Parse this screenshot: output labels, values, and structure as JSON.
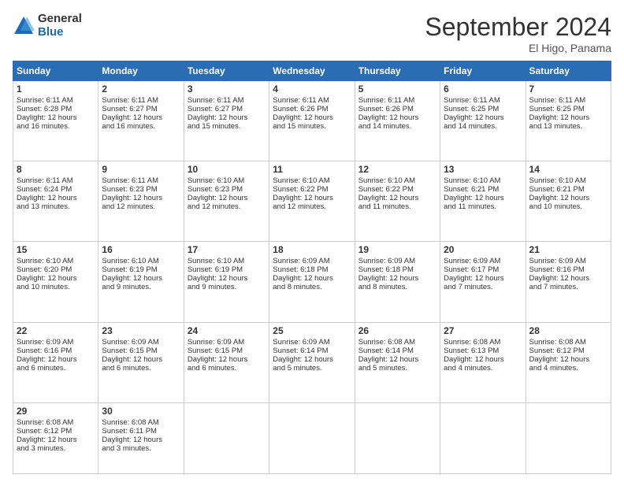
{
  "header": {
    "logo_general": "General",
    "logo_blue": "Blue",
    "month_title": "September 2024",
    "location": "El Higo, Panama"
  },
  "days_of_week": [
    "Sunday",
    "Monday",
    "Tuesday",
    "Wednesday",
    "Thursday",
    "Friday",
    "Saturday"
  ],
  "weeks": [
    [
      {
        "day": 1,
        "sunrise": "6:11 AM",
        "sunset": "6:28 PM",
        "daylight": "12 hours and 16 minutes."
      },
      {
        "day": 2,
        "sunrise": "6:11 AM",
        "sunset": "6:27 PM",
        "daylight": "12 hours and 16 minutes."
      },
      {
        "day": 3,
        "sunrise": "6:11 AM",
        "sunset": "6:27 PM",
        "daylight": "12 hours and 15 minutes."
      },
      {
        "day": 4,
        "sunrise": "6:11 AM",
        "sunset": "6:26 PM",
        "daylight": "12 hours and 15 minutes."
      },
      {
        "day": 5,
        "sunrise": "6:11 AM",
        "sunset": "6:26 PM",
        "daylight": "12 hours and 14 minutes."
      },
      {
        "day": 6,
        "sunrise": "6:11 AM",
        "sunset": "6:25 PM",
        "daylight": "12 hours and 14 minutes."
      },
      {
        "day": 7,
        "sunrise": "6:11 AM",
        "sunset": "6:25 PM",
        "daylight": "12 hours and 13 minutes."
      }
    ],
    [
      {
        "day": 8,
        "sunrise": "6:11 AM",
        "sunset": "6:24 PM",
        "daylight": "12 hours and 13 minutes."
      },
      {
        "day": 9,
        "sunrise": "6:11 AM",
        "sunset": "6:23 PM",
        "daylight": "12 hours and 12 minutes."
      },
      {
        "day": 10,
        "sunrise": "6:10 AM",
        "sunset": "6:23 PM",
        "daylight": "12 hours and 12 minutes."
      },
      {
        "day": 11,
        "sunrise": "6:10 AM",
        "sunset": "6:22 PM",
        "daylight": "12 hours and 12 minutes."
      },
      {
        "day": 12,
        "sunrise": "6:10 AM",
        "sunset": "6:22 PM",
        "daylight": "12 hours and 11 minutes."
      },
      {
        "day": 13,
        "sunrise": "6:10 AM",
        "sunset": "6:21 PM",
        "daylight": "12 hours and 11 minutes."
      },
      {
        "day": 14,
        "sunrise": "6:10 AM",
        "sunset": "6:21 PM",
        "daylight": "12 hours and 10 minutes."
      }
    ],
    [
      {
        "day": 15,
        "sunrise": "6:10 AM",
        "sunset": "6:20 PM",
        "daylight": "12 hours and 10 minutes."
      },
      {
        "day": 16,
        "sunrise": "6:10 AM",
        "sunset": "6:19 PM",
        "daylight": "12 hours and 9 minutes."
      },
      {
        "day": 17,
        "sunrise": "6:10 AM",
        "sunset": "6:19 PM",
        "daylight": "12 hours and 9 minutes."
      },
      {
        "day": 18,
        "sunrise": "6:09 AM",
        "sunset": "6:18 PM",
        "daylight": "12 hours and 8 minutes."
      },
      {
        "day": 19,
        "sunrise": "6:09 AM",
        "sunset": "6:18 PM",
        "daylight": "12 hours and 8 minutes."
      },
      {
        "day": 20,
        "sunrise": "6:09 AM",
        "sunset": "6:17 PM",
        "daylight": "12 hours and 7 minutes."
      },
      {
        "day": 21,
        "sunrise": "6:09 AM",
        "sunset": "6:16 PM",
        "daylight": "12 hours and 7 minutes."
      }
    ],
    [
      {
        "day": 22,
        "sunrise": "6:09 AM",
        "sunset": "6:16 PM",
        "daylight": "12 hours and 6 minutes."
      },
      {
        "day": 23,
        "sunrise": "6:09 AM",
        "sunset": "6:15 PM",
        "daylight": "12 hours and 6 minutes."
      },
      {
        "day": 24,
        "sunrise": "6:09 AM",
        "sunset": "6:15 PM",
        "daylight": "12 hours and 6 minutes."
      },
      {
        "day": 25,
        "sunrise": "6:09 AM",
        "sunset": "6:14 PM",
        "daylight": "12 hours and 5 minutes."
      },
      {
        "day": 26,
        "sunrise": "6:08 AM",
        "sunset": "6:14 PM",
        "daylight": "12 hours and 5 minutes."
      },
      {
        "day": 27,
        "sunrise": "6:08 AM",
        "sunset": "6:13 PM",
        "daylight": "12 hours and 4 minutes."
      },
      {
        "day": 28,
        "sunrise": "6:08 AM",
        "sunset": "6:12 PM",
        "daylight": "12 hours and 4 minutes."
      }
    ],
    [
      {
        "day": 29,
        "sunrise": "6:08 AM",
        "sunset": "6:12 PM",
        "daylight": "12 hours and 3 minutes."
      },
      {
        "day": 30,
        "sunrise": "6:08 AM",
        "sunset": "6:11 PM",
        "daylight": "12 hours and 3 minutes."
      },
      null,
      null,
      null,
      null,
      null
    ]
  ],
  "labels": {
    "sunrise": "Sunrise:",
    "sunset": "Sunset:",
    "daylight": "Daylight:"
  }
}
